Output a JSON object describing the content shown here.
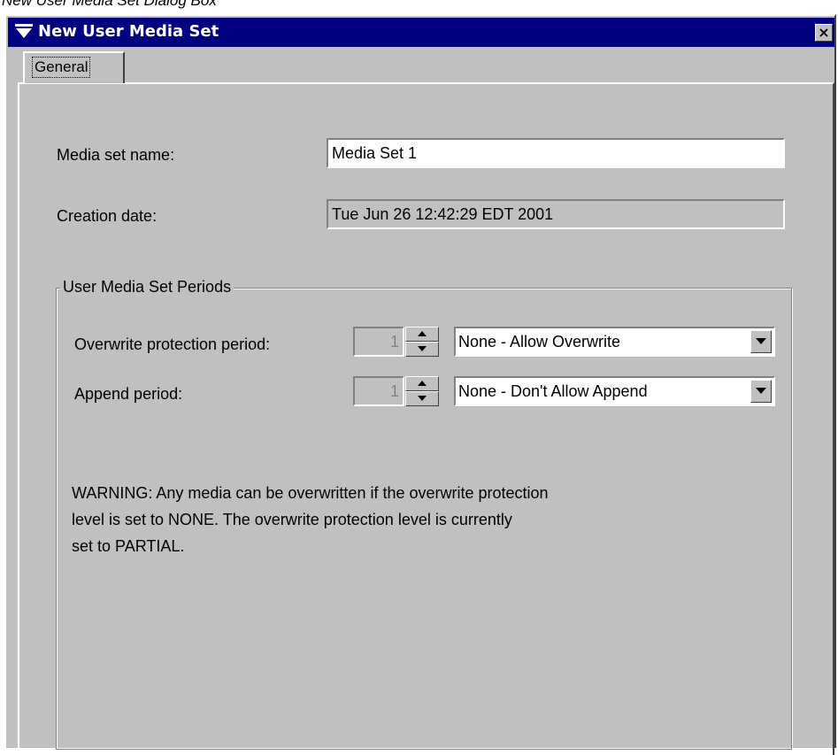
{
  "figure_caption": "New User Media Set Dialog Box",
  "window": {
    "title": "New User Media Set",
    "close_glyph": "×"
  },
  "tabs": [
    {
      "label": "General",
      "selected": true
    }
  ],
  "form": {
    "media_set_name": {
      "label": "Media set name:",
      "value": "Media Set 1"
    },
    "creation_date": {
      "label": "Creation date:",
      "value": "Tue Jun 26 12:42:29 EDT 2001"
    }
  },
  "periods": {
    "group_title": "User Media Set Periods",
    "overwrite": {
      "label": "Overwrite protection period:",
      "spinner_value": "1",
      "selected_option": "None - Allow Overwrite"
    },
    "append": {
      "label": "Append period:",
      "spinner_value": "1",
      "selected_option": "None - Don't Allow Append"
    }
  },
  "warning": {
    "line1": "WARNING:  Any media can be overwritten if the overwrite protection",
    "line2": "level is set to NONE. The overwrite protection level is currently",
    "line3": "set to PARTIAL."
  },
  "icons": {
    "window_menu": "window-menu-icon",
    "close": "close-icon",
    "spin_up": "spin-up-arrow-icon",
    "spin_down": "spin-down-arrow-icon",
    "dropdown": "dropdown-arrow-icon"
  },
  "colors": {
    "titlebar": "#000080",
    "dialog_face": "#c0c0c0",
    "field_background": "#ffffff"
  }
}
